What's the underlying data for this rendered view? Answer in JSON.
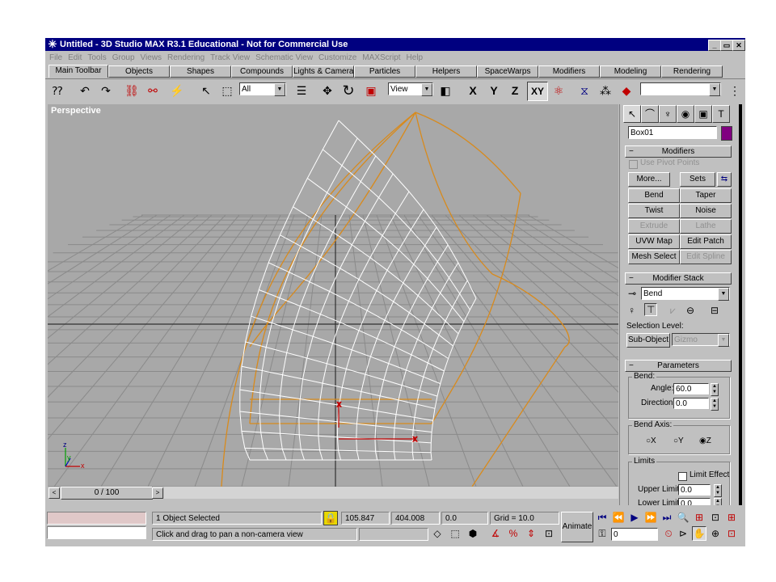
{
  "window": {
    "title": "Untitled - 3D Studio MAX R3.1 Educational - Not for Commercial Use",
    "controls": {
      "minimize": "_",
      "maximize": "▭",
      "close": "✕"
    }
  },
  "menu": [
    "File",
    "Edit",
    "Tools",
    "Group",
    "Views",
    "Rendering",
    "Track View",
    "Schematic View",
    "Customize",
    "MAXScript",
    "Help"
  ],
  "tabs": [
    "Main Toolbar",
    "Objects",
    "Shapes",
    "Compounds",
    "Lights & Cameras",
    "Particles",
    "Helpers",
    "SpaceWarps",
    "Modifiers",
    "Modeling",
    "Rendering"
  ],
  "toolbar": {
    "selection_filter": "All",
    "ref_coord": "View",
    "axis_x": "X",
    "axis_y": "Y",
    "axis_z": "Z",
    "axis_xy": "XY",
    "named_selection": ""
  },
  "viewport": {
    "label": "Perspective"
  },
  "timeline": {
    "frame": "0 / 100",
    "prev": "<",
    "next": ">"
  },
  "command_panel": {
    "object_name": "Box01",
    "object_color": "#800080",
    "modifiers": {
      "title": "Modifiers",
      "use_pivot_points": "Use Pivot Points",
      "more": "More...",
      "sets": "Sets",
      "buttons": [
        "Bend",
        "Taper",
        "Twist",
        "Noise",
        "Extrude",
        "Lathe",
        "UVW Map",
        "Edit Patch",
        "Mesh Select",
        "Edit Spline"
      ]
    },
    "modifier_stack": {
      "title": "Modifier Stack",
      "current": "Bend",
      "selection_level": "Selection Level:",
      "sub_object": "Sub-Object",
      "gizmo": "Gizmo"
    },
    "parameters": {
      "title": "Parameters",
      "bend_group": "Bend:",
      "angle_label": "Angle:",
      "angle_value": "60.0",
      "direction_label": "Direction:",
      "direction_value": "0.0",
      "bend_axis_group": "Bend Axis:",
      "axis_x": "X",
      "axis_y": "Y",
      "axis_z": "Z",
      "limits_group": "Limits",
      "limit_effect": "Limit Effect",
      "upper_limit_label": "Upper Limit:",
      "upper_limit_value": "0.0",
      "lower_limit_label": "Lower Limit:",
      "lower_limit_value": "0.0"
    }
  },
  "status": {
    "selection": "1 Object Selected",
    "prompt": "Click and drag to pan a non-camera view",
    "x": "105.847",
    "y": "404.008",
    "z": "0.0",
    "grid": "Grid = 10.0",
    "animate": "Animate",
    "current_frame": "0"
  }
}
